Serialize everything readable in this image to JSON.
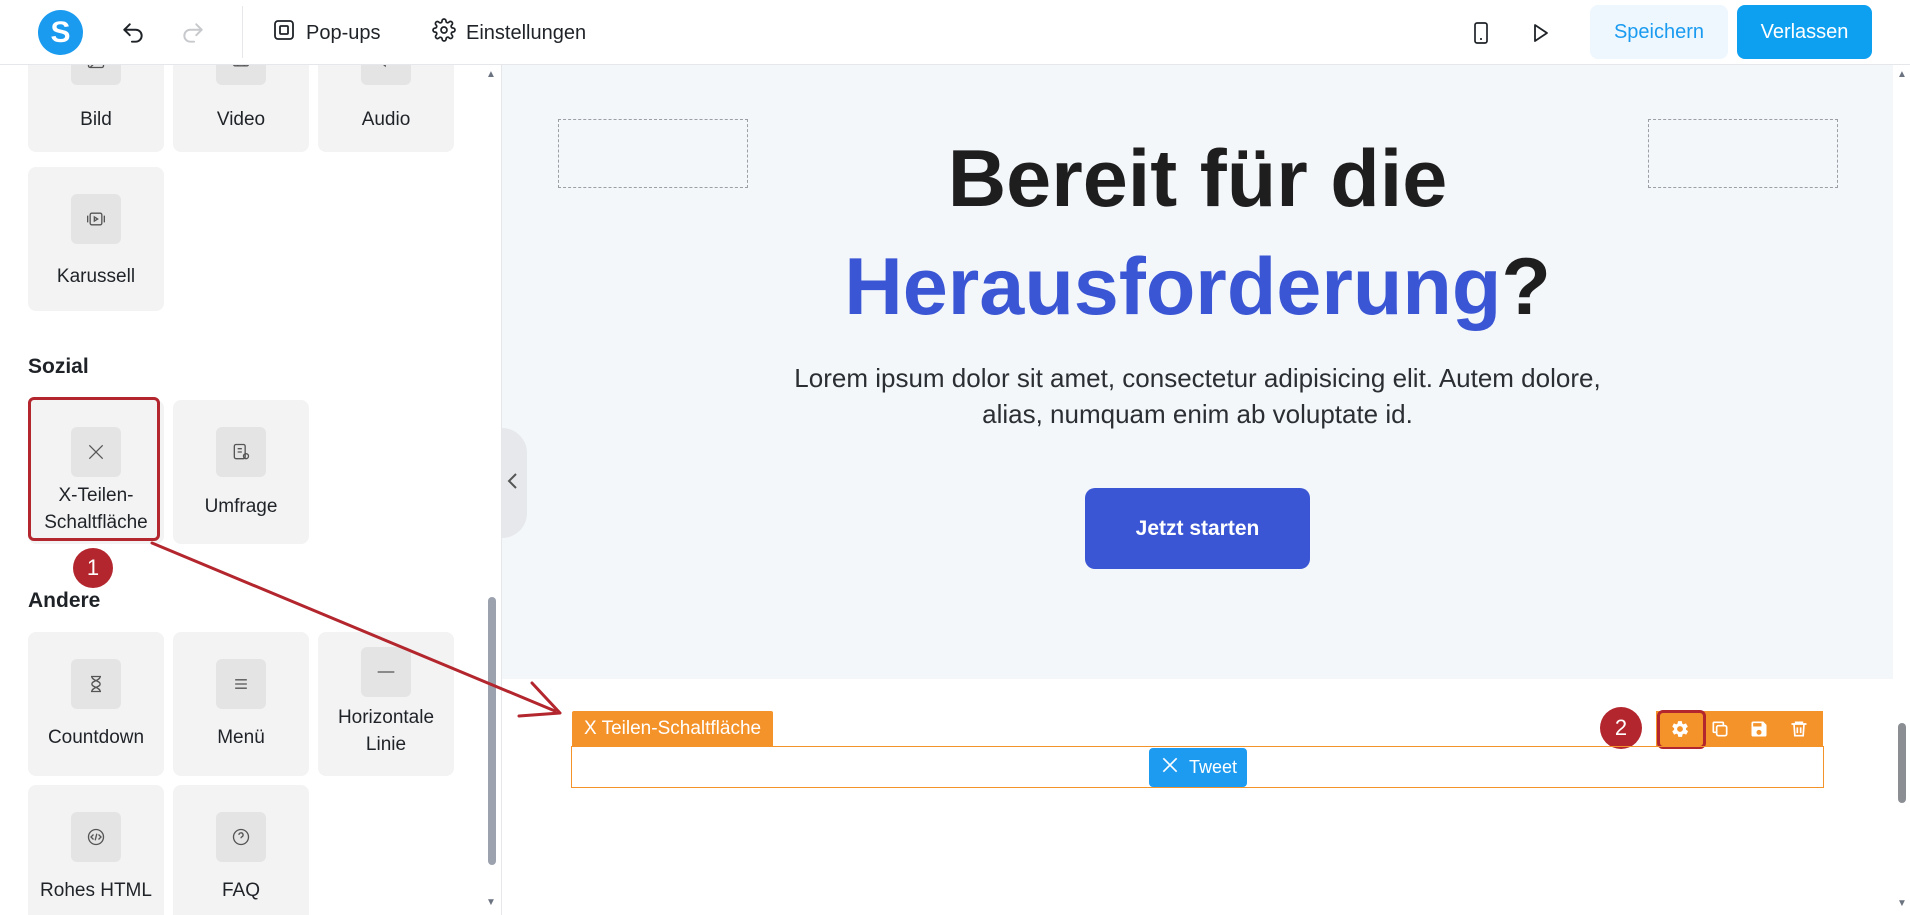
{
  "app": {
    "logo_letter": "S",
    "toolbar": {
      "popups_label": "Pop-ups",
      "settings_label": "Einstellungen",
      "save_label": "Speichern",
      "leave_label": "Verlassen"
    }
  },
  "sidebar": {
    "media_tiles": [
      {
        "label": "Bild",
        "icon": "image-icon"
      },
      {
        "label": "Video",
        "icon": "video-icon"
      },
      {
        "label": "Audio",
        "icon": "audio-icon"
      },
      {
        "label": "Karussell",
        "icon": "carousel-icon"
      }
    ],
    "social": {
      "title": "Sozial",
      "tiles": [
        {
          "label": "X-Teilen-Schaltfläche",
          "icon": "x-logo-icon"
        },
        {
          "label": "Umfrage",
          "icon": "poll-icon"
        }
      ]
    },
    "other": {
      "title": "Andere",
      "tiles": [
        {
          "label": "Countdown",
          "icon": "hourglass-icon"
        },
        {
          "label": "Menü",
          "icon": "menu-icon"
        },
        {
          "label": "Horizontale Linie",
          "icon": "horizontal-line-icon"
        },
        {
          "label": "Rohes HTML",
          "icon": "code-icon"
        },
        {
          "label": "FAQ",
          "icon": "question-icon"
        }
      ]
    }
  },
  "canvas": {
    "hero": {
      "title_line1": "Bereit für die",
      "title_accent": "Herausforderung",
      "title_suffix": "?",
      "text": "Lorem ipsum dolor sit amet, consectetur adipisicing elit. Autem dolore, alias, numquam enim ab voluptate id.",
      "cta_label": "Jetzt starten"
    },
    "block": {
      "label": "X Teilen-Schaltfläche",
      "tweet_label": "Tweet",
      "tools": [
        "settings-icon",
        "copy-icon",
        "save-icon",
        "delete-icon"
      ]
    }
  },
  "annotations": {
    "step1": "1",
    "step2": "2",
    "color": "#b3262d"
  },
  "colors": {
    "brand": "#1a9bf0",
    "accent": "#3a56d4",
    "block_orange": "#f5932b",
    "tweet_blue": "#1d9bf0"
  }
}
